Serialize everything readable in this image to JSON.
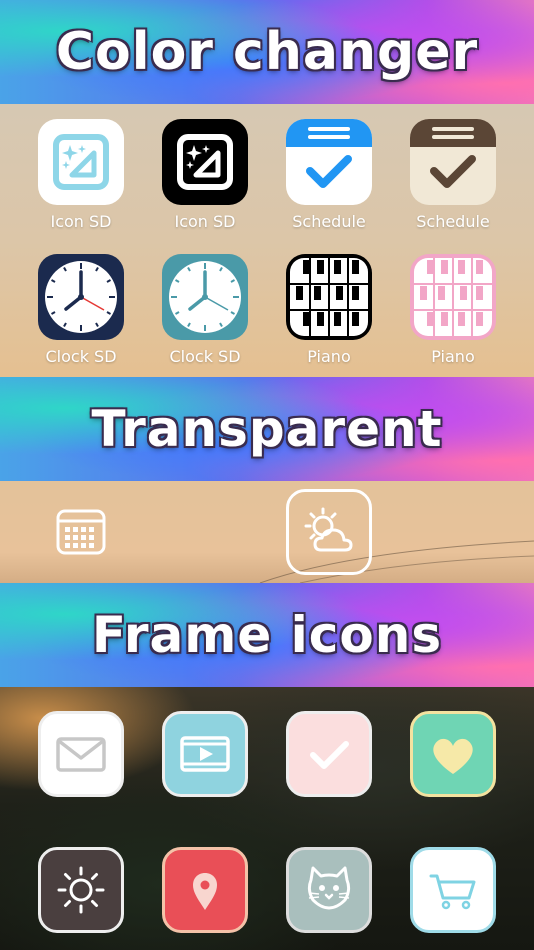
{
  "banners": {
    "color_changer": "Color changer",
    "transparent": "Transparent",
    "frame_icons": "Frame icons"
  },
  "color_changer_apps": [
    {
      "label": "Icon SD",
      "icon": "icon-sd-light-icon",
      "color": "#ffffff"
    },
    {
      "label": "Icon SD",
      "icon": "icon-sd-dark-icon",
      "color": "#000000"
    },
    {
      "label": "Schedule",
      "icon": "schedule-blue-icon",
      "color": "#2196f3"
    },
    {
      "label": "Schedule",
      "icon": "schedule-brown-icon",
      "color": "#5b4636"
    },
    {
      "label": "Clock SD",
      "icon": "clock-navy-icon",
      "color": "#1b2a4e"
    },
    {
      "label": "Clock SD",
      "icon": "clock-teal-icon",
      "color": "#4a9aa8"
    },
    {
      "label": "Piano",
      "icon": "piano-black-icon",
      "color": "#000000"
    },
    {
      "label": "Piano",
      "icon": "piano-pink-icon",
      "color": "#f2a6c7"
    }
  ],
  "transparent_icons": [
    {
      "icon": "calendar-outline-icon"
    },
    {
      "icon": "weather-partly-cloudy-icon"
    }
  ],
  "frame_icons": [
    {
      "icon": "mail-icon",
      "color": "#ffffff"
    },
    {
      "icon": "video-play-icon",
      "color": "#8fd3df"
    },
    {
      "icon": "checkmark-icon",
      "color": "#fbdede"
    },
    {
      "icon": "heart-icon",
      "color": "#6fd5b4"
    },
    {
      "icon": "sun-icon",
      "color": "#4a3f3f"
    },
    {
      "icon": "map-pin-icon",
      "color": "#e94f57"
    },
    {
      "icon": "cat-icon",
      "color": "#a9bfbd"
    },
    {
      "icon": "shopping-cart-icon",
      "color": "#ffffff"
    }
  ]
}
